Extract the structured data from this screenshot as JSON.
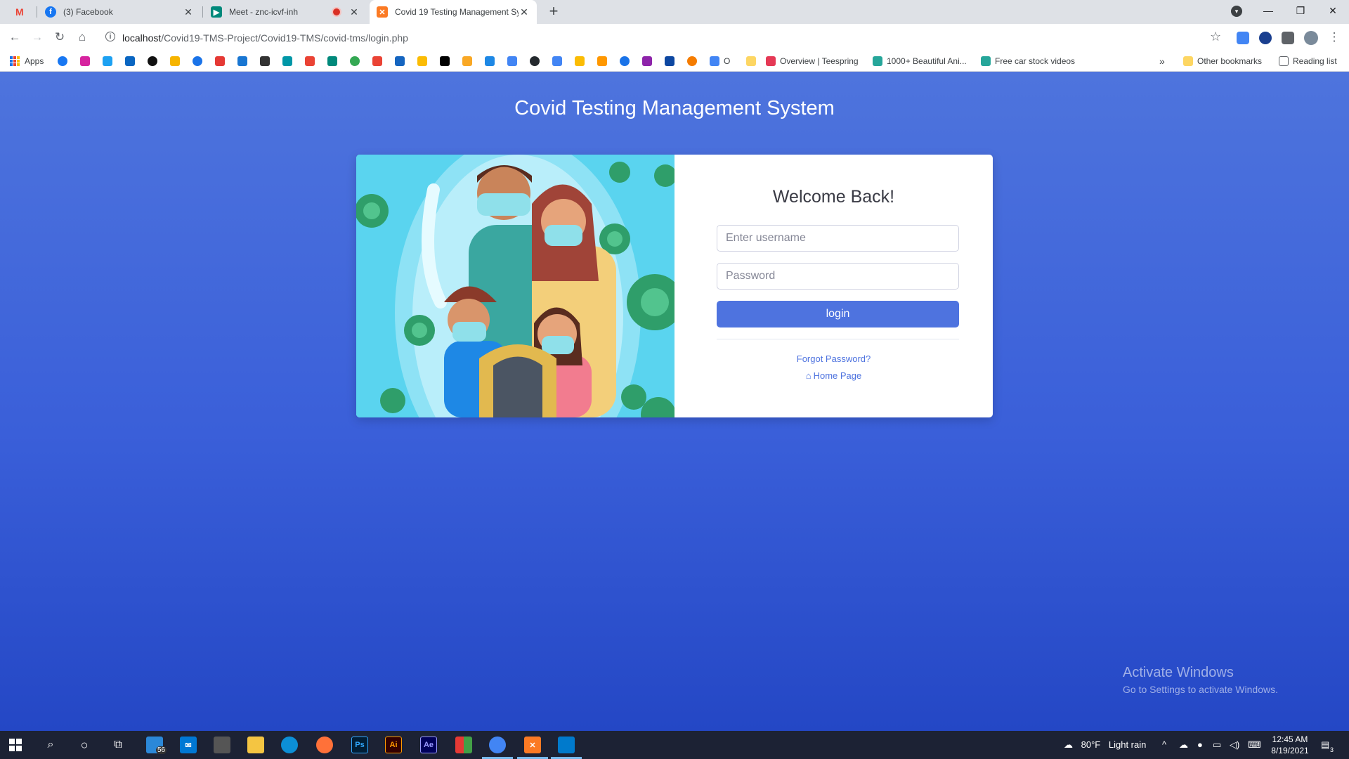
{
  "browser": {
    "tabs": [
      {
        "label": "",
        "favicon": "gmail-icon"
      },
      {
        "label": "(3) Facebook",
        "favicon": "facebook-icon"
      },
      {
        "label": "Meet - znc-icvf-inh",
        "favicon": "meet-icon"
      },
      {
        "label": "Covid 19 Testing Management Sy",
        "favicon": "xampp-icon",
        "active": true
      }
    ],
    "url_host": "localhost",
    "url_path": "/Covid19-TMS-Project/Covid19-TMS/covid-tms/login.php",
    "bookmarks": {
      "apps": "Apps",
      "overview": "Overview | Teespring",
      "beautiful": "1000+ Beautiful Ani...",
      "car": "Free car stock videos",
      "o": "O",
      "chevrons": "»",
      "other": "Other bookmarks",
      "reading": "Reading list"
    }
  },
  "page": {
    "title": "Covid Testing Management System",
    "welcome": "Welcome Back!",
    "username_placeholder": "Enter username",
    "password_placeholder": "Password",
    "login_label": "login",
    "forgot_label": "Forgot Password?",
    "home_label": "Home Page",
    "colors": {
      "primary": "#4e73df",
      "background": "#3a5fd9"
    }
  },
  "watermark": {
    "line1": "Activate Windows",
    "line2": "Go to Settings to activate Windows."
  },
  "taskbar": {
    "badge": "56",
    "weather_temp": "80°F",
    "weather_text": "Light rain",
    "time": "12:45 AM",
    "date": "8/19/2021",
    "notifications": "3",
    "apps": [
      "Ps",
      "Ai",
      "Ae"
    ]
  }
}
